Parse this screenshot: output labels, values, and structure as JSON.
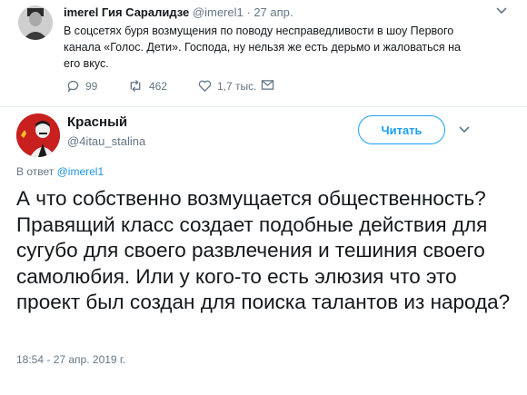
{
  "quoted_tweet": {
    "name": "imerel Гия Саралидзе",
    "handle": "@imerel1",
    "separator": "·",
    "date": "27 апр.",
    "text": "В соцсетях буря возмущения по поводу несправедливости в шоу Первого канала «Голос. Дети». Господа, ну нельзя же есть дерьмо и жаловаться на его вкус.",
    "actions": {
      "replies": "99",
      "retweets": "462",
      "likes": "1,7 тыс."
    }
  },
  "main_tweet": {
    "name": "Красный",
    "handle": "@4itau_stalina",
    "follow_label": "Читать",
    "reply_prefix": "В ответ",
    "reply_to": "@imerel1",
    "text": "А что собственно возмущается общественность? Правящий класс создает подобные действия для сугубо для своего развлечения и тешиния своего самолюбия. Или у кого-то есть элюзия что это проект был создан для поиска талантов из народа?",
    "timestamp": "18:54 - 27 апр. 2019 г."
  },
  "colors": {
    "accent": "#1da1f2",
    "muted": "#657786",
    "text": "#14171a",
    "avatar_red": "#c81f1f"
  }
}
